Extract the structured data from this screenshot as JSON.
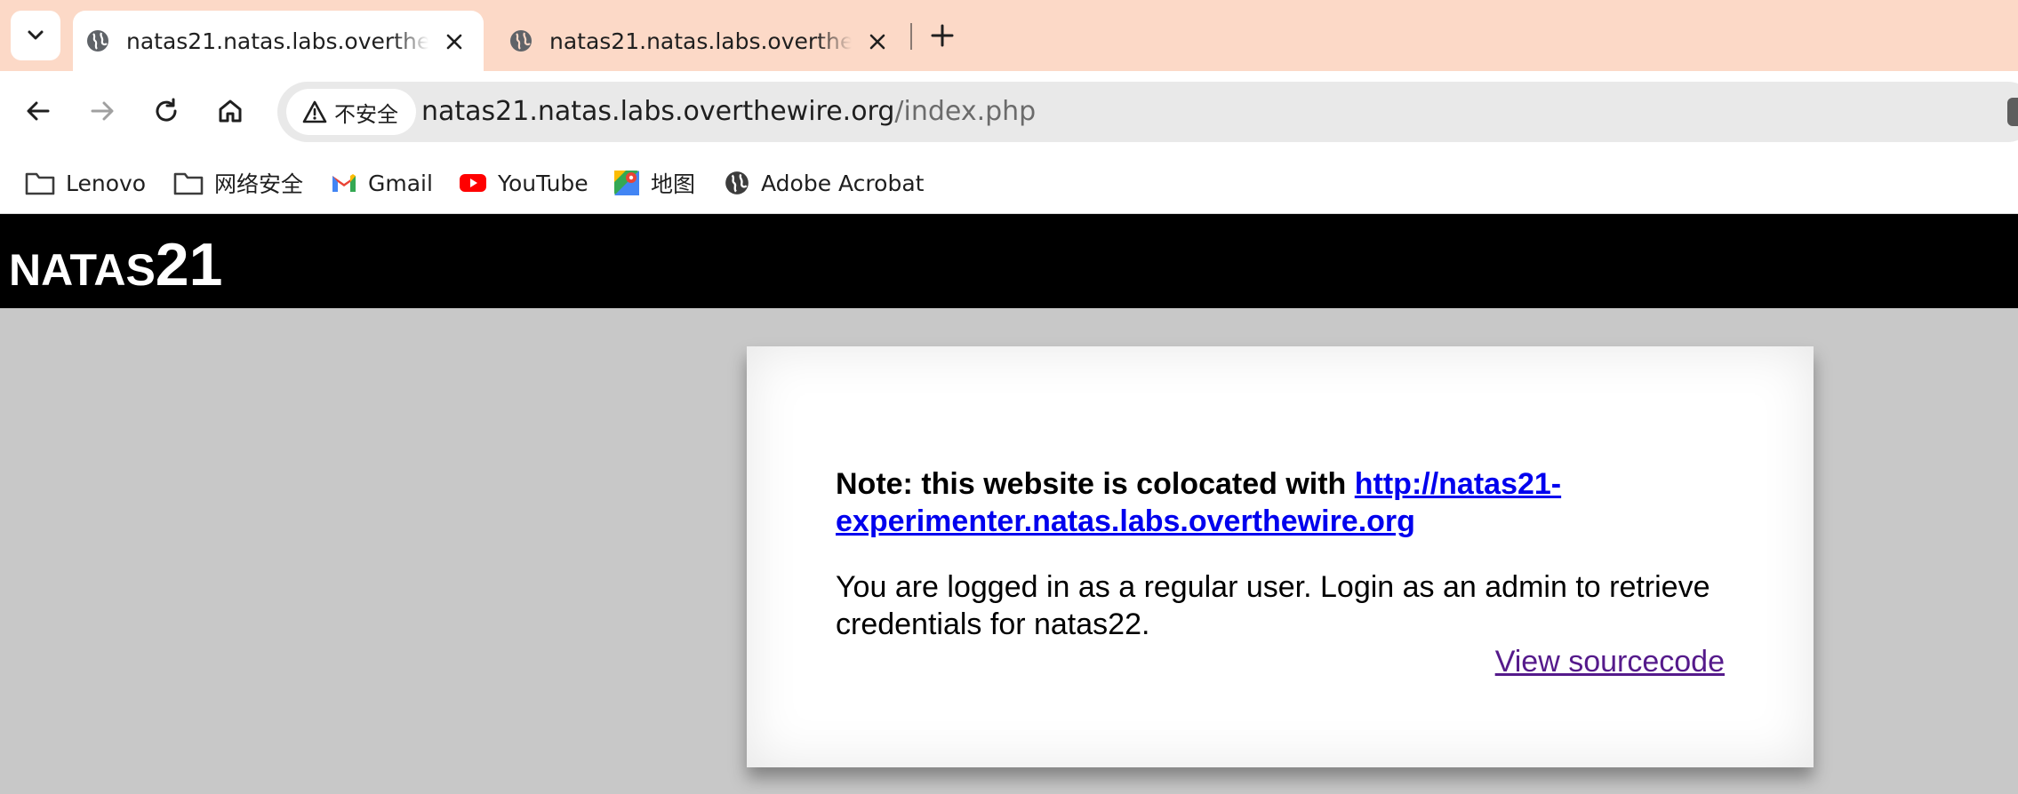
{
  "tabs": [
    {
      "title": "natas21.natas.labs.overthewire.org",
      "active": true
    },
    {
      "title": "natas21.natas.labs.overthewire.org",
      "active": false
    }
  ],
  "omnibox": {
    "security_label": "不安全",
    "url_host": "natas21.natas.labs.overthewire.org",
    "url_path": "/index.php"
  },
  "bookmarks": [
    {
      "label": "Lenovo",
      "icon": "folder-icon"
    },
    {
      "label": "网络安全",
      "icon": "folder-icon"
    },
    {
      "label": "Gmail",
      "icon": "gmail-icon"
    },
    {
      "label": "YouTube",
      "icon": "youtube-icon"
    },
    {
      "label": "地图",
      "icon": "maps-icon"
    },
    {
      "label": "Adobe Acrobat",
      "icon": "globe-icon"
    }
  ],
  "page": {
    "header_word": "NATAS",
    "header_number": "21",
    "note_prefix": "Note: this website is colocated with ",
    "note_link_line1": "http://natas21-",
    "note_link_line2": "experimenter.natas.labs.overthewire.org",
    "message": "You are logged in as a regular user. Login as an admin to retrieve credentials for natas22.",
    "source_link": "View sourcecode"
  },
  "colors": {
    "tabbar_bg": "#fcd9c7",
    "page_bg": "#c8c8c8",
    "header_bg": "#000000",
    "link": "#0000ee",
    "visited_link": "#551a8b"
  }
}
